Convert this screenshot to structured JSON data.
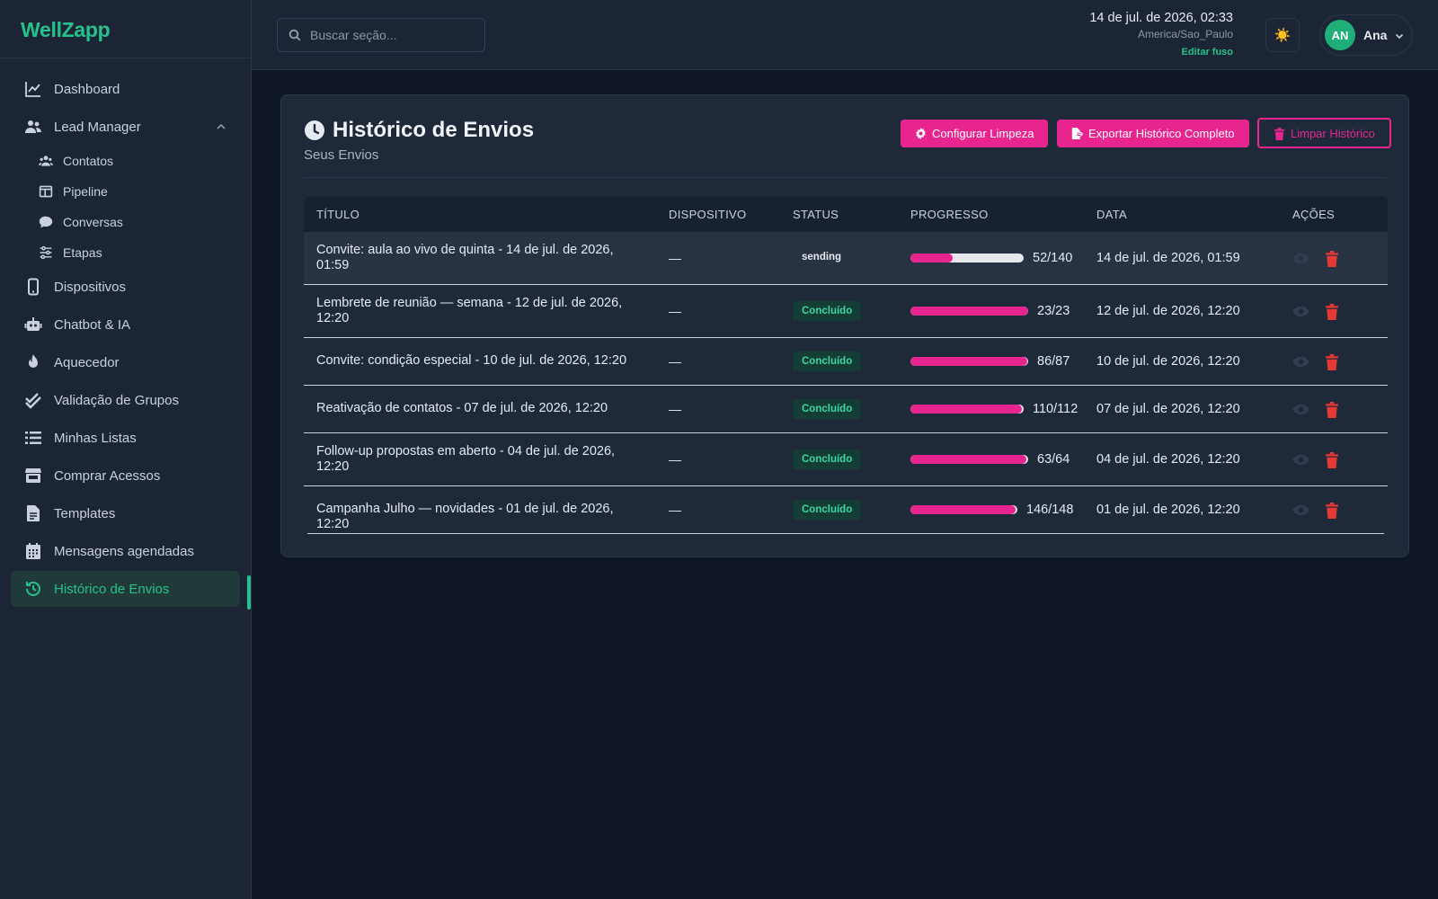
{
  "brand": "WellZapp",
  "sidebar": {
    "items": [
      {
        "label": "Dashboard",
        "icon": "chart-line-icon"
      },
      {
        "label": "Lead Manager",
        "icon": "users-icon"
      },
      {
        "label": "Contatos",
        "icon": "contacts-icon"
      },
      {
        "label": "Pipeline",
        "icon": "pipeline-icon"
      },
      {
        "label": "Conversas",
        "icon": "chat-icon"
      },
      {
        "label": "Etapas",
        "icon": "sliders-icon"
      },
      {
        "label": "Dispositivos",
        "icon": "mobile-icon"
      },
      {
        "label": "Chatbot & IA",
        "icon": "robot-icon"
      },
      {
        "label": "Aquecedor",
        "icon": "flame-icon"
      },
      {
        "label": "Validação de Grupos",
        "icon": "double-check-icon"
      },
      {
        "label": "Minhas Listas",
        "icon": "list-icon"
      },
      {
        "label": "Comprar Acessos",
        "icon": "store-icon"
      },
      {
        "label": "Templates",
        "icon": "file-icon"
      },
      {
        "label": "Mensagens agendadas",
        "icon": "calendar-icon"
      },
      {
        "label": "Histórico de Envios",
        "icon": "history-icon"
      }
    ]
  },
  "header": {
    "search_placeholder": "Buscar seção...",
    "datetime": "14 de jul. de 2026, 02:33",
    "timezone": "America/Sao_Paulo",
    "edit_tz": "Editar fuso",
    "theme_icon": "☀️",
    "user_initials": "AN",
    "user_name": "Ana"
  },
  "page": {
    "title": "Histórico de Envios",
    "subtitle": "Seus Envios",
    "btn_config": "Configurar Limpeza",
    "btn_export": "Exportar Histórico Completo",
    "btn_clear": "Limpar Histórico"
  },
  "table": {
    "headers": [
      "TÍTULO",
      "DISPOSITIVO",
      "STATUS",
      "PROGRESSO",
      "DATA",
      "AÇÕES"
    ],
    "rows": [
      {
        "title": "Convite: aula ao vivo de quinta - 14 de jul. de 2026, 01:59",
        "device": "—",
        "status": "sending",
        "progress": "52/140",
        "fraction": 0.371,
        "date": "14 de jul. de 2026, 01:59"
      },
      {
        "title": "Lembrete de reunião — semana - 12 de jul. de 2026, 12:20",
        "device": "—",
        "status": "Concluído",
        "progress": "23/23",
        "fraction": 1.0,
        "date": "12 de jul. de 2026, 12:20"
      },
      {
        "title": "Convite: condição especial - 10 de jul. de 2026, 12:20",
        "device": "—",
        "status": "Concluído",
        "progress": "86/87",
        "fraction": 0.989,
        "date": "10 de jul. de 2026, 12:20"
      },
      {
        "title": "Reativação de contatos - 07 de jul. de 2026, 12:20",
        "device": "—",
        "status": "Concluído",
        "progress": "110/112",
        "fraction": 0.982,
        "date": "07 de jul. de 2026, 12:20"
      },
      {
        "title": "Follow-up propostas em aberto - 04 de jul. de 2026, 12:20",
        "device": "—",
        "status": "Concluído",
        "progress": "63/64",
        "fraction": 0.984,
        "date": "04 de jul. de 2026, 12:20"
      },
      {
        "title": "Campanha Julho — novidades - 01 de jul. de 2026, 12:20",
        "device": "—",
        "status": "Concluído",
        "progress": "146/148",
        "fraction": 0.986,
        "date": "01 de jul. de 2026, 12:20"
      }
    ]
  },
  "colors": {
    "accent_green": "#25c28c",
    "accent_pink": "#e8258f",
    "danger": "#e53935",
    "background": "#0f1623",
    "panel": "#1b2535"
  }
}
